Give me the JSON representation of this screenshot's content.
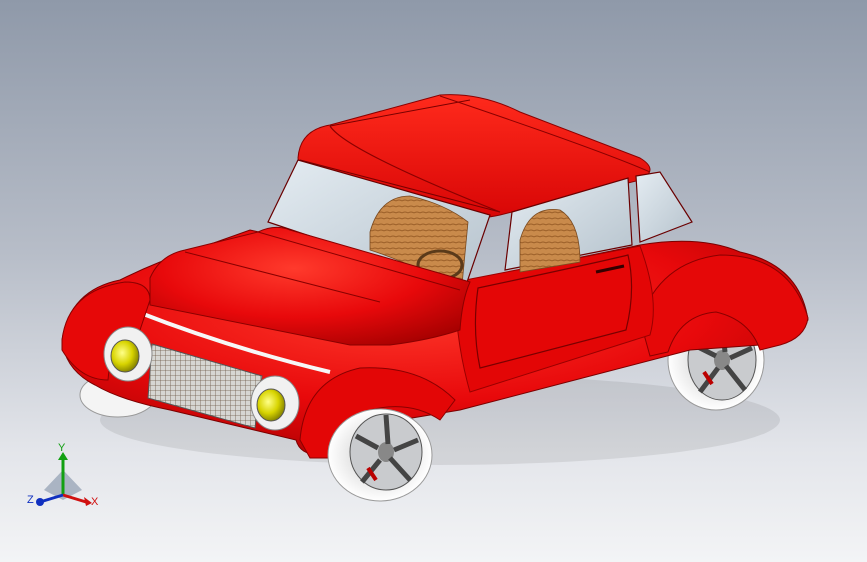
{
  "viewport": {
    "model": "car-assembly"
  },
  "triad": {
    "x_label": "X",
    "y_label": "Y",
    "z_label": "Z"
  },
  "colors": {
    "body": "#e8090b",
    "body_shadow": "#a50000",
    "glass": "#c9d6de",
    "upholstery": "#c98a4b",
    "rim": "#d7d9dc",
    "tire": "#f2f2f2",
    "headlight": "#d8d400",
    "x_axis": "#d01010",
    "y_axis": "#12a012",
    "z_axis": "#1030c0"
  }
}
